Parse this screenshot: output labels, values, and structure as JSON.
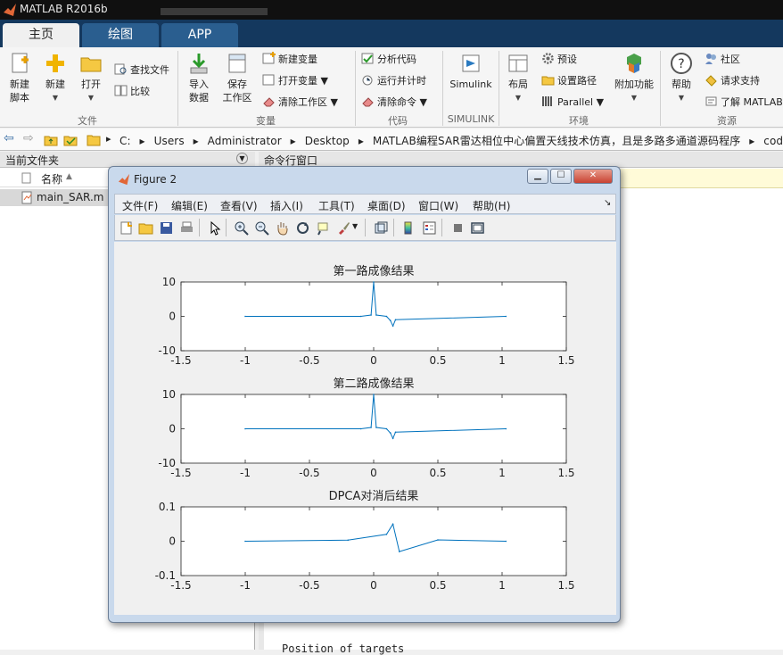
{
  "app": {
    "title": "MATLAB R2016b"
  },
  "tabs": [
    {
      "label": "主页"
    },
    {
      "label": "绘图"
    },
    {
      "label": "APP"
    }
  ],
  "ribbon": {
    "file": {
      "new_script": "新建\n脚本",
      "new": "新建",
      "open": "打开",
      "find_files": "查找文件",
      "compare": "比较",
      "group": "文件"
    },
    "variable": {
      "import": "导入\n数据",
      "save_ws": "保存\n工作区",
      "new_var": "新建变量",
      "open_var": "打开变量",
      "clear_ws": "清除工作区",
      "group": "变量"
    },
    "code": {
      "analyze": "分析代码",
      "run_time": "运行并计时",
      "clear_cmd": "清除命令",
      "group": "代码"
    },
    "simulink": {
      "label": "Simulink",
      "group": "SIMULINK"
    },
    "env": {
      "layout": "布局",
      "prefs": "预设",
      "set_path": "设置路径",
      "parallel": "Parallel",
      "addons": "附加功能",
      "group": "环境"
    },
    "resources": {
      "help": "帮助",
      "community": "社区",
      "support": "请求支持",
      "learn": "了解 MATLAB",
      "group": "资源"
    }
  },
  "path": {
    "parts": [
      "C:",
      "Users",
      "Administrator",
      "Desktop",
      "MATLAB编程SAR雷达相位中心偏置天线技术仿真，且是多路多通道源码程序",
      "code"
    ]
  },
  "current_folder": {
    "title": "当前文件夹",
    "col_name": "名称",
    "files": [
      {
        "name": "main_SAR.m"
      }
    ]
  },
  "command_window": {
    "title": "命令行窗口",
    "output_line": "Position of targets"
  },
  "figure": {
    "title": "Figure 2",
    "menu": [
      "文件(F)",
      "编辑(E)",
      "查看(V)",
      "插入(I)",
      "工具(T)",
      "桌面(D)",
      "窗口(W)",
      "帮助(H)"
    ],
    "toolbar_icons": [
      "new-figure-icon",
      "open-icon",
      "save-icon",
      "print-icon",
      "pointer-icon",
      "zoom-in-icon",
      "zoom-out-icon",
      "pan-icon",
      "rotate-icon",
      "data-cursor-icon",
      "brush-icon",
      "link-icon",
      "colorbar-icon",
      "legend-icon",
      "hide-tools-icon",
      "dock-icon"
    ]
  },
  "colors": {
    "line": "#0072bd",
    "ribbon_bg": "#f5f5f5",
    "tabbar": "#14385e",
    "figure_frame": "#c9d9ec"
  },
  "chart_data": [
    {
      "type": "line",
      "title": "第一路成像结果",
      "xlim": [
        -1.5,
        1.5
      ],
      "ylim": [
        -10,
        10
      ],
      "xticks": [
        "-1.5",
        "-1",
        "-0.5",
        "0",
        "0.5",
        "1",
        "1.5"
      ],
      "yticks": [
        "10",
        "0",
        "-10"
      ],
      "series": [
        {
          "x": [
            -1,
            -0.1,
            -0.02,
            0,
            0.02,
            0.1,
            0.13,
            0.15,
            0.17,
            1.03
          ],
          "values": [
            0,
            0,
            0.4,
            10,
            0.4,
            0,
            -1.2,
            -2.8,
            -1,
            0
          ]
        }
      ]
    },
    {
      "type": "line",
      "title": "第二路成像结果",
      "xlim": [
        -1.5,
        1.5
      ],
      "ylim": [
        -10,
        10
      ],
      "xticks": [
        "-1.5",
        "-1",
        "-0.5",
        "0",
        "0.5",
        "1",
        "1.5"
      ],
      "yticks": [
        "10",
        "0",
        "-10"
      ],
      "series": [
        {
          "x": [
            -1,
            -0.1,
            -0.02,
            0,
            0.02,
            0.1,
            0.13,
            0.15,
            0.17,
            1.03
          ],
          "values": [
            0,
            0,
            0.4,
            10,
            0.4,
            0,
            -1.2,
            -2.8,
            -1,
            0
          ]
        }
      ]
    },
    {
      "type": "line",
      "title": "DPCA对消后结果",
      "xlim": [
        -1.5,
        1.5
      ],
      "ylim": [
        -0.1,
        0.1
      ],
      "xticks": [
        "-1.5",
        "-1",
        "-0.5",
        "0",
        "0.5",
        "1",
        "1.5"
      ],
      "yticks": [
        "0.1",
        "0",
        "-0.1"
      ],
      "series": [
        {
          "x": [
            -1,
            -0.2,
            0.1,
            0.15,
            0.2,
            0.5,
            1.03
          ],
          "values": [
            0,
            0.003,
            0.02,
            0.05,
            -0.03,
            0.004,
            0
          ]
        }
      ]
    }
  ]
}
